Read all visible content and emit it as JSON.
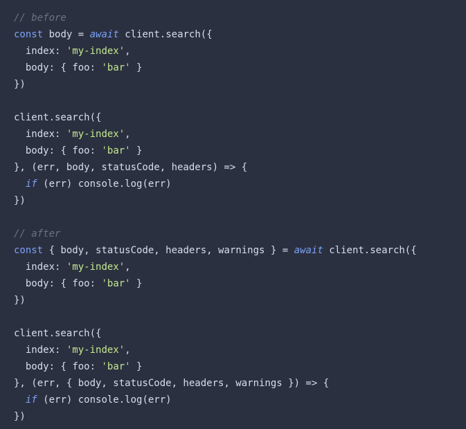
{
  "code": {
    "l1": {
      "comment": "// before"
    },
    "l2": {
      "kw_const": "const",
      "sp1": " ",
      "var_body": "body",
      "sp2": " ",
      "eq": "=",
      "sp3": " ",
      "kw_await": "await",
      "sp4": " ",
      "call": "client.search({"
    },
    "l3": {
      "indent": "  ",
      "key": "index:",
      "sp": " ",
      "str": "'my-index'",
      "comma": ","
    },
    "l4": {
      "indent": "  ",
      "key": "body:",
      "sp": " ",
      "open": "{ ",
      "fkey": "foo:",
      "sp2": " ",
      "str": "'bar'",
      "close": " }"
    },
    "l5": {
      "text": "})"
    },
    "l6": {
      "blank": ""
    },
    "l7": {
      "text": "client.search({"
    },
    "l8": {
      "indent": "  ",
      "key": "index:",
      "sp": " ",
      "str": "'my-index'",
      "comma": ","
    },
    "l9": {
      "indent": "  ",
      "key": "body:",
      "sp": " ",
      "open": "{ ",
      "fkey": "foo:",
      "sp2": " ",
      "str": "'bar'",
      "close": " }"
    },
    "l10": {
      "text": "}, (err, body, statusCode, headers) => {"
    },
    "l11": {
      "indent": "  ",
      "kw_if": "if",
      "sp": " ",
      "rest": "(err) console.log(err)"
    },
    "l12": {
      "text": "})"
    },
    "l13": {
      "blank": ""
    },
    "l14": {
      "comment": "// after"
    },
    "l15": {
      "kw_const": "const",
      "sp1": " ",
      "destruct": "{ body, statusCode, headers, warnings }",
      "sp2": " ",
      "eq": "=",
      "sp3": " ",
      "kw_await": "await",
      "sp4": " ",
      "call": "client.search({"
    },
    "l16": {
      "indent": "  ",
      "key": "index:",
      "sp": " ",
      "str": "'my-index'",
      "comma": ","
    },
    "l17": {
      "indent": "  ",
      "key": "body:",
      "sp": " ",
      "open": "{ ",
      "fkey": "foo:",
      "sp2": " ",
      "str": "'bar'",
      "close": " }"
    },
    "l18": {
      "text": "})"
    },
    "l19": {
      "blank": ""
    },
    "l20": {
      "text": "client.search({"
    },
    "l21": {
      "indent": "  ",
      "key": "index:",
      "sp": " ",
      "str": "'my-index'",
      "comma": ","
    },
    "l22": {
      "indent": "  ",
      "key": "body:",
      "sp": " ",
      "open": "{ ",
      "fkey": "foo:",
      "sp2": " ",
      "str": "'bar'",
      "close": " }"
    },
    "l23": {
      "text": "}, (err, { body, statusCode, headers, warnings }) => {"
    },
    "l24": {
      "indent": "  ",
      "kw_if": "if",
      "sp": " ",
      "rest": "(err) console.log(err)"
    },
    "l25": {
      "text": "})"
    }
  }
}
